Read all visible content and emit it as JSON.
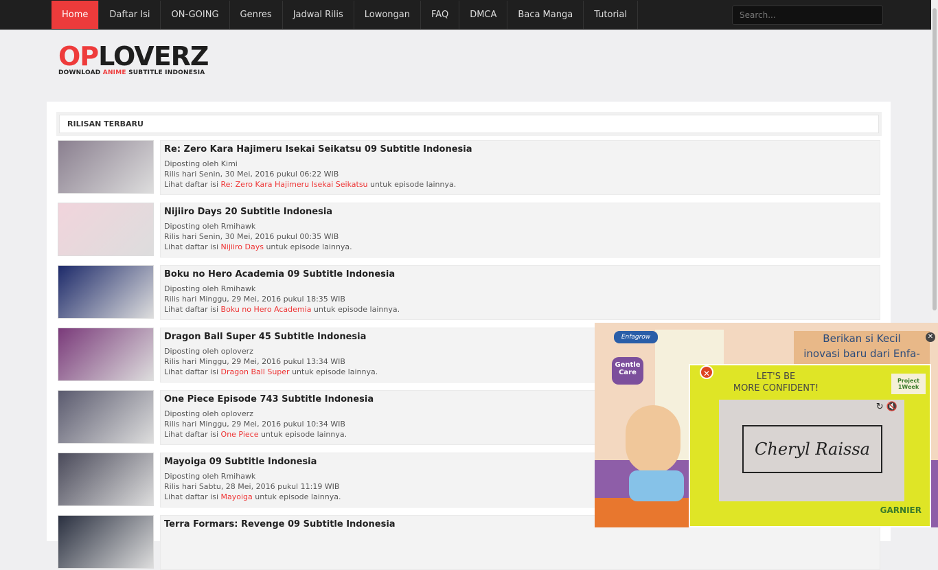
{
  "nav": {
    "items": [
      "Home",
      "Daftar Isi",
      "ON-GOING",
      "Genres",
      "Jadwal Rilis",
      "Lowongan",
      "FAQ",
      "DMCA",
      "Baca Manga",
      "Tutorial"
    ],
    "active": "Home",
    "search_placeholder": "Search..."
  },
  "logo": {
    "name": "OPLOVERZ",
    "tagline": "DOWNLOAD ANIME SUBTITLE INDONESIA"
  },
  "section_title": "RILISAN TERBARU",
  "posts": [
    {
      "title": "Re: Zero Kara Hajimeru Isekai Seikatsu 09 Subtitle Indonesia",
      "by": "Diposting oleh Kimi",
      "date": "Rilis hari Senin, 30 Mei, 2016 pukul 06:22 WIB",
      "pre": "Lihat daftar isi ",
      "link": "Re: Zero Kara Hajimeru Isekai Seikatsu",
      "post": " untuk episode lainnya.",
      "color": "#8a7f8f"
    },
    {
      "title": "Nijiiro Days 20 Subtitle Indonesia",
      "by": "Diposting oleh Rmihawk",
      "date": "Rilis hari Senin, 30 Mei, 2016 pukul 00:35 WIB",
      "pre": "Lihat daftar isi ",
      "link": "Nijiiro Days",
      "post": " untuk episode lainnya.",
      "color": "#f1d4dc"
    },
    {
      "title": "Boku no Hero Academia 09 Subtitle Indonesia",
      "by": "Diposting oleh Rmihawk",
      "date": "Rilis hari Minggu, 29 Mei, 2016 pukul 18:35 WIB",
      "pre": "Lihat daftar isi ",
      "link": "Boku no Hero Academia",
      "post": " untuk episode lainnya.",
      "color": "#1d2a6a"
    },
    {
      "title": "Dragon Ball Super 45 Subtitle Indonesia",
      "by": "Diposting oleh oploverz",
      "date": "Rilis hari Minggu, 29 Mei, 2016 pukul 13:34 WIB",
      "pre": "Lihat daftar isi ",
      "link": "Dragon Ball Super",
      "post": " untuk episode lainnya.",
      "color": "#7a3a7a"
    },
    {
      "title": "One Piece Episode 743 Subtitle Indonesia",
      "by": "Diposting oleh oploverz",
      "date": "Rilis hari Minggu, 29 Mei, 2016 pukul 10:34 WIB",
      "pre": "Lihat daftar isi ",
      "link": "One Piece",
      "post": " untuk episode lainnya.",
      "color": "#5a5a6e"
    },
    {
      "title": "Mayoiga 09 Subtitle Indonesia",
      "by": "Diposting oleh Rmihawk",
      "date": "Rilis hari Sabtu, 28 Mei, 2016 pukul 11:19 WIB",
      "pre": "Lihat daftar isi ",
      "link": "Mayoiga",
      "post": " untuk episode lainnya.",
      "color": "#4a4a5a"
    },
    {
      "title": "Terra Formars: Revenge 09 Subtitle Indonesia",
      "by": "",
      "date": "",
      "pre": "",
      "link": "",
      "post": "",
      "color": "#2a3040"
    }
  ],
  "ads": {
    "enfagrow": {
      "brand": "Enfagrow",
      "badge": "Gentle Care",
      "text1": "Berikan si Kecil",
      "text2": "inovasi baru dari Enfa-"
    },
    "garnier": {
      "headline1": "LET'S BE",
      "headline2": "MORE CONFIDENT!",
      "name": "Cheryl Raissa",
      "brand": "GARNIER",
      "badge": "Project 1Week"
    }
  }
}
